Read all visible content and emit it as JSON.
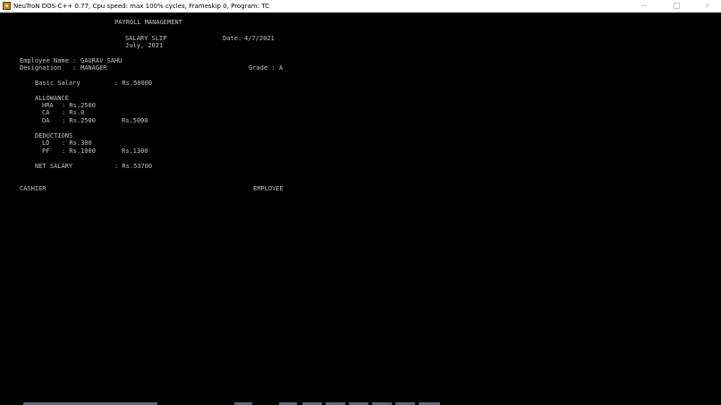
{
  "window": {
    "title": "NeuTroN DOS-C++ 0.77, Cpu speed: max 100% cycles, Frameskip  0, Program:     TC"
  },
  "screen": {
    "header": "PAYROLL MANAGEMENT",
    "slip_title": "SALARY SLIP",
    "date_label": "Date:",
    "date_value": "4/7/2021",
    "month": "July, 2021",
    "employee_name_label": "Employee Name :",
    "employee_name": "GAURAV SAHU",
    "designation_label": "Designation   :",
    "designation": "MANAGER",
    "grade_label": "Grade :",
    "grade": "A",
    "basic_salary_label": "Basic Salary",
    "basic_salary_value": ": Rs.50000",
    "allowance_heading": "ALLOWANCE",
    "allowances": [
      {
        "label": "HRA",
        "value": ": Rs.2500"
      },
      {
        "label": "CA",
        "value": ": Rs.0"
      },
      {
        "label": "DA",
        "value": ": Rs.2500"
      }
    ],
    "allowance_total": "Rs.5000",
    "deductions_heading": "DEDUCTIONS",
    "deductions": [
      {
        "label": "LD",
        "value": ": Rs.300"
      },
      {
        "label": "PF",
        "value": ": Rs.1000"
      }
    ],
    "deductions_total": "Rs.1300",
    "net_salary_label": "NET SALARY",
    "net_salary_value": ": Rs.53700",
    "cashier_label": "CASHIER",
    "employee_label": "EMPLOYEE"
  },
  "colors": {
    "screen_bg": "#000000",
    "screen_text": "#c2c2c2",
    "titlebar_bg": "#ffffff"
  }
}
